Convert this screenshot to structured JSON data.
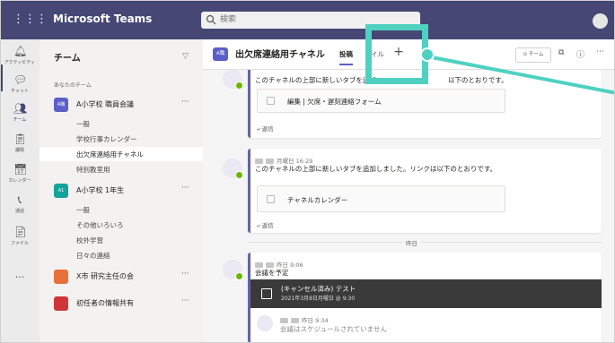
{
  "topbar": {
    "app_title": "Microsoft Teams",
    "waffle_icon": "waffle-icon",
    "search_placeholder": "検索",
    "avatar_icon": "user-avatar"
  },
  "rail": {
    "items": [
      {
        "label": "アクティビティ",
        "icon": "bell-icon",
        "glyph": "🔔︎"
      },
      {
        "label": "チャット",
        "icon": "chat-icon",
        "glyph": "💬︎"
      },
      {
        "label": "チーム",
        "icon": "teams-icon",
        "glyph": "👥︎"
      },
      {
        "label": "課題",
        "icon": "assignments-icon",
        "glyph": "📋︎"
      },
      {
        "label": "カレンダー",
        "icon": "calendar-icon",
        "glyph": "📅︎"
      },
      {
        "label": "通話",
        "icon": "call-icon",
        "glyph": "📞︎"
      },
      {
        "label": "ファイル",
        "icon": "files-icon",
        "glyph": "📄︎"
      }
    ],
    "more": "..."
  },
  "sidebar": {
    "title": "チーム",
    "section_label": "あなたのチーム",
    "teams": [
      {
        "avatar": "A職",
        "name": "A小学校 職員会議",
        "color": "#5b5fc7",
        "channels": [
          "一般",
          "学校行事カレンダー",
          "出欠席連絡用チャネル",
          "特別教室用"
        ],
        "selected_index": 2
      },
      {
        "avatar": "A1",
        "name": "A小学校 1年生",
        "color": "#13a39a",
        "channels": [
          "一般",
          "その他いろいろ",
          "校外学習",
          "日々の連絡"
        ]
      },
      {
        "avatar": "",
        "name": "X市 研究主任の会",
        "color": "#e8703a"
      },
      {
        "avatar": "",
        "name": "初任者の情報共有",
        "color": "#d13438"
      }
    ]
  },
  "header": {
    "badge": "A職",
    "title": "出欠席連絡用チャネル",
    "tab_posts": "投稿",
    "tab_files": "イル",
    "add_tab": "+",
    "team_button": "⊙ チーム",
    "meet_icon": "video-icon",
    "info_icon": "info-icon",
    "more_icon": "more-icon"
  },
  "messages": {
    "post1": {
      "text": "このチャネルの上部に新しいタブを追加",
      "text_tail": "以下のとおりです。",
      "card": "編集 | 欠席・遅刻連絡フォーム",
      "reply": "返信"
    },
    "post2": {
      "time": "月曜日 16:29",
      "text": "このチャネルの上部に新しいタブを追加しました。リンクは以下のとおりです。",
      "card": "チャネルカレンダー",
      "reply": "返信"
    },
    "divider": "昨日",
    "post3": {
      "time": "昨日 9:06",
      "text": "会議を予定",
      "meeting_title": "(キャンセル済み) テスト",
      "meeting_date": "2021年3月8日月曜日 @ 9:30",
      "sub_time": "昨日 9:34",
      "sub_text": "会議はスケジュールされていません"
    }
  },
  "colors": {
    "brand": "#464775",
    "accent": "#6264a7",
    "highlight": "#4ed1c1"
  }
}
